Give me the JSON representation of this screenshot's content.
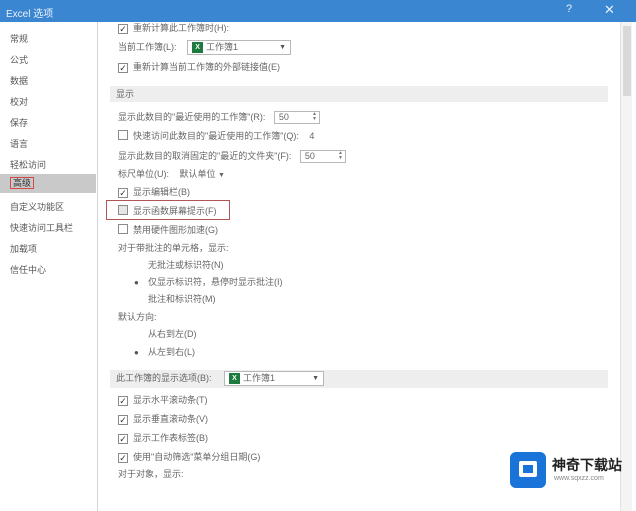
{
  "window": {
    "title": "Excel 选项",
    "help": "?",
    "close": "✕"
  },
  "sidebar": {
    "items": [
      {
        "label": "常规",
        "active": false
      },
      {
        "label": "公式",
        "active": false
      },
      {
        "label": "数据",
        "active": false
      },
      {
        "label": "校对",
        "active": false
      },
      {
        "label": "保存",
        "active": false
      },
      {
        "label": "语言",
        "active": false
      },
      {
        "label": "轻松访问",
        "active": false
      },
      {
        "label": "高级",
        "active": true
      },
      {
        "label": "自定义功能区",
        "active": false
      },
      {
        "label": "快速访问工具栏",
        "active": false
      },
      {
        "label": "加载项",
        "active": false
      },
      {
        "label": "信任中心",
        "active": false
      }
    ]
  },
  "content": {
    "top_cut_option": "重新计算此工作簿时(H):",
    "current_workbook_label": "当前工作簿(L):",
    "current_workbook_value": "工作簿1",
    "formula_save_option": "重新计算当前工作簿的外部链接值(E)",
    "display_section": "显示",
    "recent_workbooks_label": "显示此数目的\"最近使用的工作簿\"(R):",
    "recent_workbooks_value": "50",
    "quick_access_option": "快速访问此数目的\"最近使用的工作簿\"(Q):",
    "quick_access_value": "4",
    "recent_folders_label": "显示此数目的取消固定的\"最近的文件夹\"(F):",
    "recent_folders_value": "50",
    "ruler_units_label": "标尺单位(U):",
    "ruler_units_value": "默认单位",
    "formula_bar_option": "显示编辑栏(B)",
    "function_tooltip_option": "显示函数屏幕提示(F)",
    "disable_hw_accel_option": "禁用硬件图形加速(G)",
    "comments_label": "对于带批注的单元格，显示:",
    "no_comments_option": "无批注或标识符(N)",
    "indicators_option": "仅显示标识符，悬停时显示批注(I)",
    "comments_and_indicators_option": "批注和标识符(M)",
    "direction_label": "默认方向:",
    "right_to_left_option": "从右到左(D)",
    "left_to_right_option": "从左到右(L)",
    "workbook_section_label": "此工作簿的显示选项(B):",
    "workbook_section_value": "工作簿1",
    "hscroll_option": "显示水平滚动条(T)",
    "vscroll_option": "显示垂直滚动条(V)",
    "sheet_tabs_option": "显示工作表标签(B)",
    "autofilter_option": "使用\"自动筛选\"菜单分组日期(G)",
    "objects_label": "对于对象，显示:"
  },
  "watermark": {
    "brand": "神奇下载站",
    "url": "www.sqxzz.com"
  }
}
